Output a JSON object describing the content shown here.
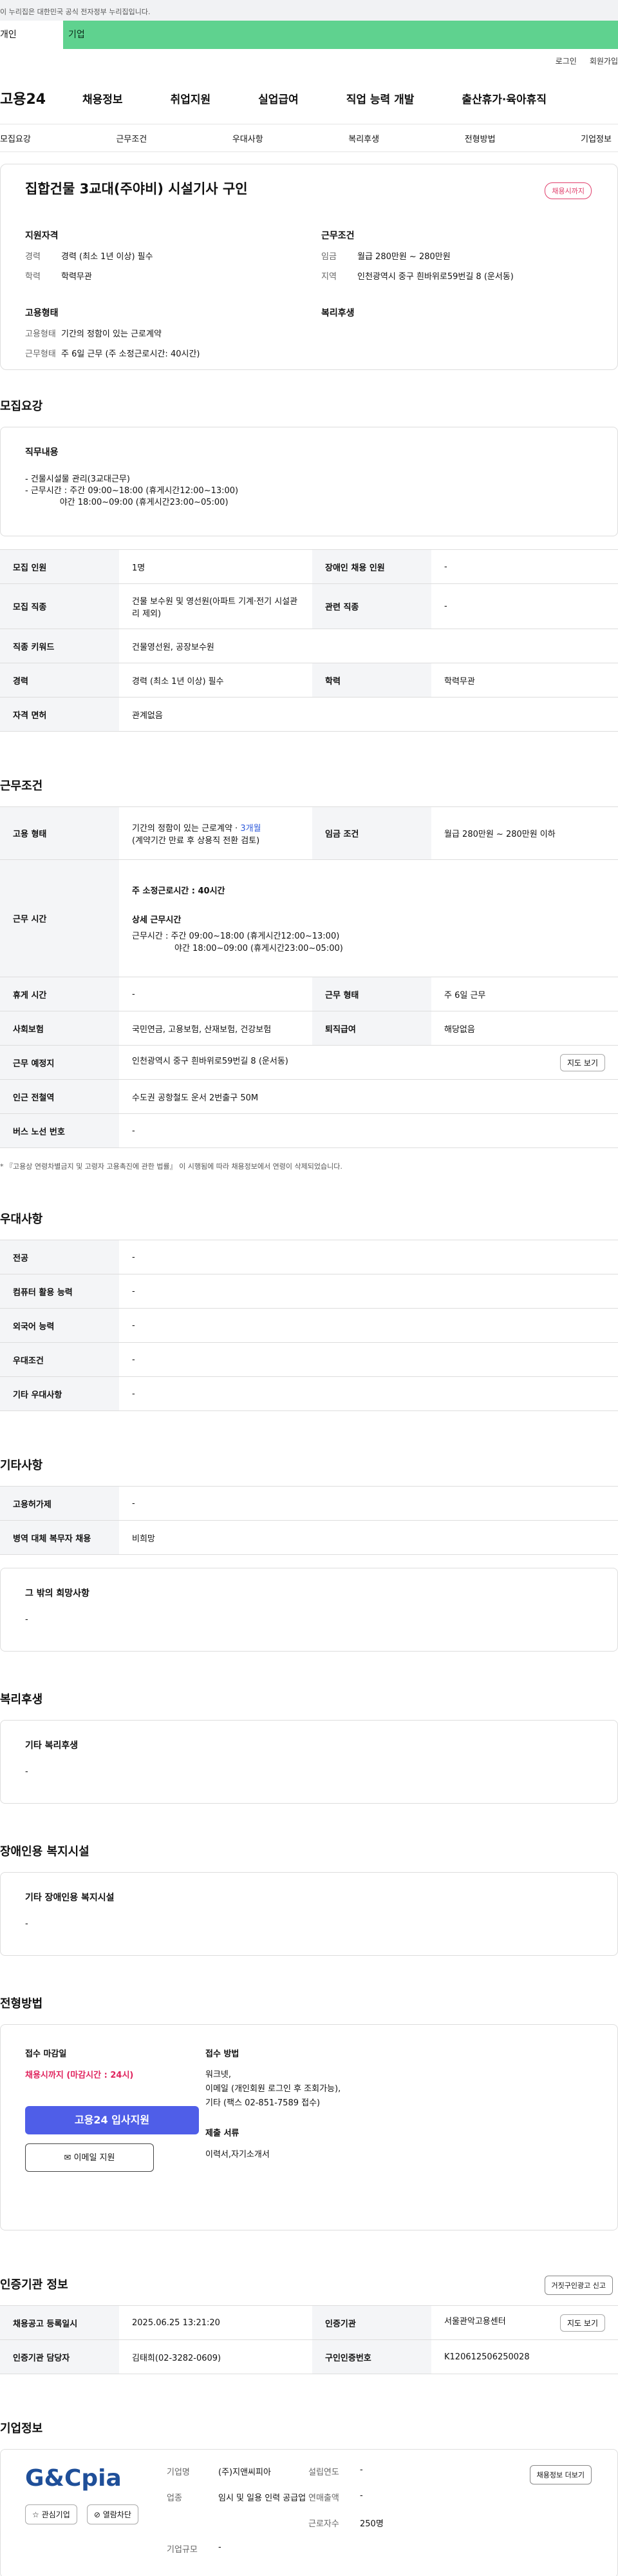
{
  "gov": "이 누리집은 대한민국 공식 전자정부 누리집입니다.",
  "tabs": [
    "개인",
    "기업"
  ],
  "util": [
    "로그인",
    "회원가입"
  ],
  "logo": "고용24",
  "gnb": [
    "채용정보",
    "취업지원",
    "실업급여",
    "직업 능력 개발",
    "출산휴가·육아휴직"
  ],
  "subnav": [
    "모집요강",
    "근무조건",
    "우대사항",
    "복리후생",
    "전형방법",
    "기업정보"
  ],
  "title": "집합건물 3교대(주야비) 시설기사 구인",
  "badge": "채용시까지",
  "summary": {
    "left_h": "지원자격",
    "right_h": "근무조건",
    "career_k": "경력",
    "career_v": "경력 (최소 1년 이상) 필수",
    "edu_k": "학력",
    "edu_v": "학력무관",
    "wage_k": "임금",
    "wage_v": "월급 280만원 ~ 280만원",
    "area_k": "지역",
    "area_v": "인천광역시 중구 흰바위로59번길 8 (운서동)",
    "emp_h": "고용형태",
    "welfare_h": "복리후생",
    "type_k": "고용형태",
    "type_v": "기간의 정함이 있는 근로계약",
    "form_k": "근무형태",
    "form_v": "주 6일 근무 (주 소정근로시간: 40시간)"
  },
  "sec1": "모집요강",
  "duty": {
    "h": "직무내용",
    "text": "- 건물시설물 관리(3교대근무)\n- 근무시간 : 주간 09:00~18:00 (휴게시간12:00~13:00)\n             야간 18:00~09:00 (휴게시간23:00~05:00)"
  },
  "t1": [
    [
      "모집 인원",
      "1명",
      "장애인 채용 인원",
      "-"
    ],
    [
      "모집 직종",
      "건물 보수원 및 영선원(아파트 기계·전기 시설관리 제외)",
      "관련 직종",
      "-"
    ],
    [
      "직종 키워드",
      "건물영선원, 공장보수원",
      "",
      ""
    ],
    [
      "경력",
      "경력 (최소 1년 이상) 필수",
      "학력",
      "학력무관"
    ],
    [
      "자격 면허",
      "관계없음",
      "",
      ""
    ]
  ],
  "sec2": "근무조건",
  "t2": {
    "emp_h": "고용 형태",
    "emp_v1": "기간의 정함이 있는 근로계약 · ",
    "emp_v2": "3개월",
    "emp_v3": "(계약기간 만료 후 상용직 전환 검토)",
    "wage_h": "임금 조건",
    "wage_v": "월급 280만원 ~ 280만원 이하",
    "time_h": "근무 시간",
    "time_v1": "주 소정근로시간 : 40시간",
    "time_v2": "상세 근무시간",
    "time_v3": "근무시간 : 주간 09:00~18:00 (휴게시간12:00~13:00)",
    "time_v4": "야간 18:00~09:00 (휴게시간23:00~05:00)",
    "rest_h": "휴게 시간",
    "rest_v": "-",
    "form_h": "근무 형태",
    "form_v": "주 6일 근무",
    "ins_h": "사회보험",
    "ins_v": "국민연금, 고용보험, 산재보험, 건강보험",
    "ret_h": "퇴직급여",
    "ret_v": "해당없음",
    "place_h": "근무 예정지",
    "place_v": "인천광역시 중구 흰바위로59번길 8 (운서동)",
    "map": "지도 보기",
    "sub_h": "인근 전철역",
    "sub_v": "수도권 공항철도 운서 2번출구 50M",
    "bus_h": "버스 노선 번호",
    "bus_v": "-"
  },
  "note": "* 『고용상 연령차별금지 및 고령자 고용촉진에 관한 법률』 이 시행됨에 따라 채용정보에서 연령이 삭제되었습니다.",
  "sec3": "우대사항",
  "t3": [
    [
      "전공",
      "-"
    ],
    [
      "컴퓨터 활용 능력",
      "-"
    ],
    [
      "외국어 능력",
      "-"
    ],
    [
      "우대조건",
      "-"
    ],
    [
      "기타 우대사항",
      "-"
    ]
  ],
  "sec4": "기타사항",
  "t4": [
    [
      "고용허가제",
      "-"
    ],
    [
      "병역 대체 복무자 채용",
      "비희망"
    ]
  ],
  "other": {
    "h": "그 밖의 희망사항",
    "v": "-"
  },
  "sec5": "복리후생",
  "welfare": {
    "h": "기타 복리후생",
    "v": "-"
  },
  "sec6": "장애인용 복지시설",
  "disab": {
    "h": "기타 장애인용 복지시설",
    "v": "-"
  },
  "sec7": "전형방법",
  "apply": {
    "h1": "접수 마감일",
    "deadline": "채용시까지 (마감시간 : 24시)",
    "btn1": "고용24 입사지원",
    "btn2": "이메일 지원",
    "h2": "접수 방법",
    "method": "워크넷,\n이메일 (개인회원 로그인 후 조회가능),\n기타 (팩스 02-851-7589 접수)",
    "h3": "제출 서류",
    "docs": "이력서,자기소개서"
  },
  "sec8": "인증기관 정보",
  "report": "거짓구인광고 신고",
  "t8": [
    [
      "채용공고 등록일시",
      "2025.06.25 13:21:20",
      "인증기관",
      "서울관악고용센터"
    ],
    [
      "인증기관 담당자",
      "김태희(02-3282-0609)",
      "구인인증번호",
      "K120612506250028"
    ]
  ],
  "map2": "지도 보기",
  "sec9": "기업정보",
  "company": {
    "logo": "G&Cpia",
    "fav": "관심기업",
    "block": "열람차단",
    "name_k": "기업명",
    "name_v": "(주)지앤씨피아",
    "year_k": "설립연도",
    "year_v": "-",
    "ind_k": "업종",
    "ind_v": "임시 및 일용 인력 공급업",
    "sales_k": "연매출액",
    "sales_v": "-",
    "emp_k": "근로자수",
    "emp_v": "250명",
    "size_k": "기업규모",
    "size_v": "-",
    "more": "채용정보 더보기"
  }
}
